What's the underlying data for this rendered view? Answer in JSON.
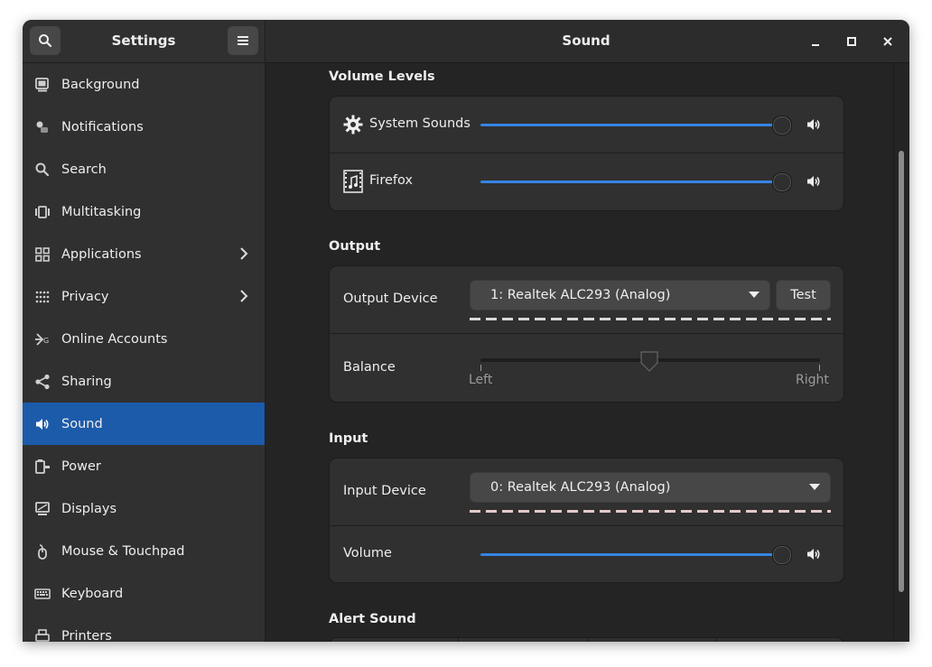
{
  "sidebar": {
    "title": "Settings",
    "items": [
      {
        "label": "Background",
        "icon": "background-icon",
        "chevron": false,
        "active": false
      },
      {
        "label": "Notifications",
        "icon": "notifications-icon",
        "chevron": false,
        "active": false
      },
      {
        "label": "Search",
        "icon": "search-icon",
        "chevron": false,
        "active": false
      },
      {
        "label": "Multitasking",
        "icon": "multitasking-icon",
        "chevron": false,
        "active": false
      },
      {
        "label": "Applications",
        "icon": "applications-icon",
        "chevron": true,
        "active": false
      },
      {
        "label": "Privacy",
        "icon": "privacy-icon",
        "chevron": true,
        "active": false
      },
      {
        "label": "Online Accounts",
        "icon": "online-accounts-icon",
        "chevron": false,
        "active": false
      },
      {
        "label": "Sharing",
        "icon": "sharing-icon",
        "chevron": false,
        "active": false
      },
      {
        "label": "Sound",
        "icon": "sound-icon",
        "chevron": false,
        "active": true
      },
      {
        "label": "Power",
        "icon": "power-icon",
        "chevron": false,
        "active": false
      },
      {
        "label": "Displays",
        "icon": "displays-icon",
        "chevron": false,
        "active": false
      },
      {
        "label": "Mouse & Touchpad",
        "icon": "mouse-icon",
        "chevron": false,
        "active": false
      },
      {
        "label": "Keyboard",
        "icon": "keyboard-icon",
        "chevron": false,
        "active": false
      },
      {
        "label": "Printers",
        "icon": "printers-icon",
        "chevron": false,
        "active": false
      }
    ]
  },
  "header": {
    "title": "Sound"
  },
  "volume_levels": {
    "title": "Volume Levels",
    "rows": [
      {
        "label": "System Sounds",
        "icon": "gear-icon",
        "level": 1.0
      },
      {
        "label": "Firefox",
        "icon": "media-icon",
        "level": 1.0
      }
    ]
  },
  "output": {
    "title": "Output",
    "device_label": "Output Device",
    "device_value": "1: Realtek ALC293 (Analog)",
    "test_label": "Test",
    "balance_label": "Balance",
    "balance_left": "Left",
    "balance_right": "Right",
    "balance_level": 0.5
  },
  "input": {
    "title": "Input",
    "device_label": "Input Device",
    "device_value": "0: Realtek ALC293 (Analog)",
    "volume_label": "Volume",
    "volume_level": 1.0
  },
  "alert": {
    "title": "Alert Sound"
  },
  "colors": {
    "accent": "#3584e4",
    "sidebar_active": "#1c5baa"
  }
}
